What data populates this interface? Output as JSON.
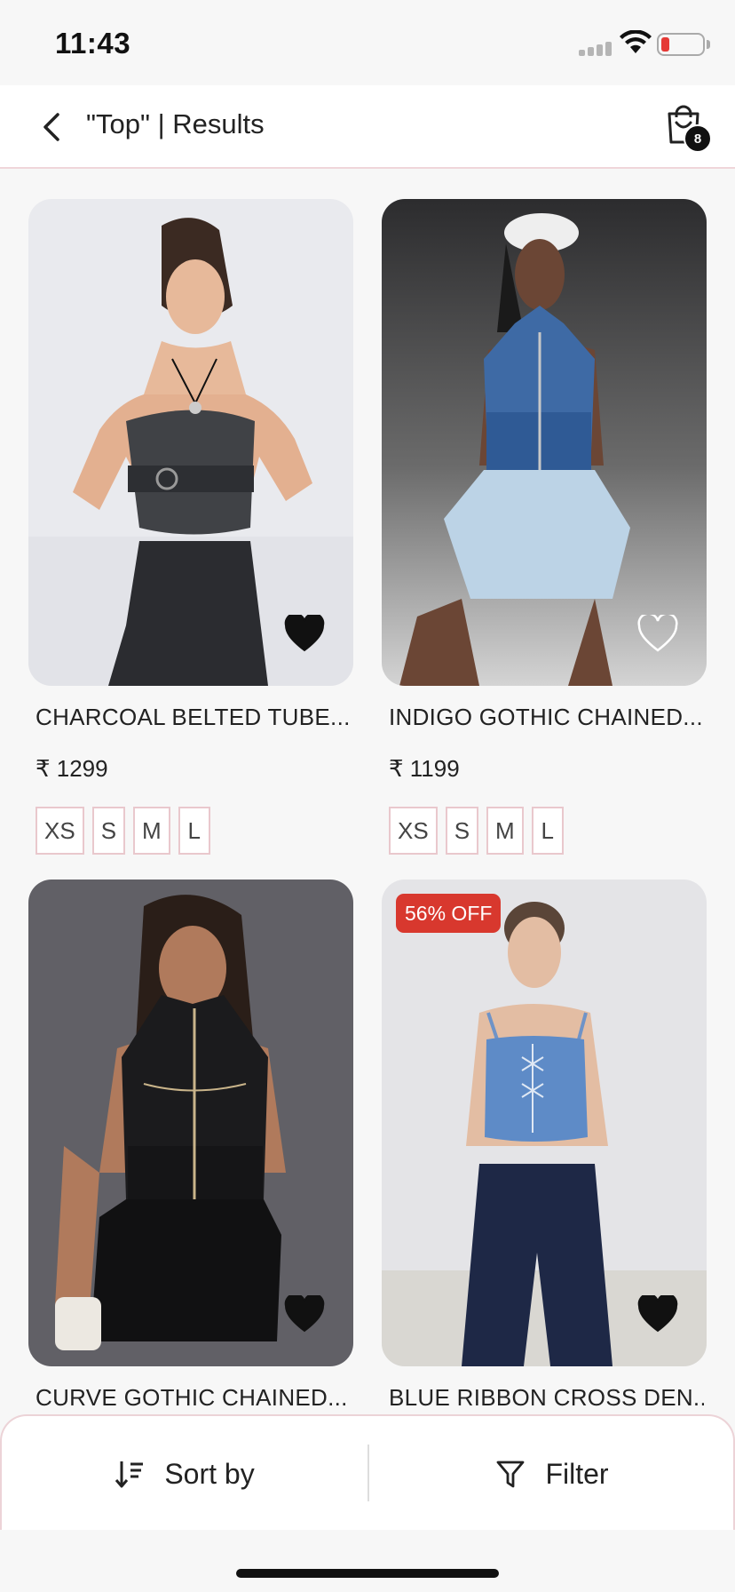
{
  "status_bar": {
    "time": "11:43"
  },
  "header": {
    "title": "\"Top\" | Results",
    "cart_count": "8"
  },
  "products": [
    {
      "name": "CHARCOAL BELTED TUBE...",
      "price": "₹ 1299",
      "sizes": [
        "XS",
        "S",
        "M",
        "L"
      ],
      "favorited": true,
      "discount": ""
    },
    {
      "name": "INDIGO GOTHIC CHAINED...",
      "price": "₹ 1199",
      "sizes": [
        "XS",
        "S",
        "M",
        "L"
      ],
      "favorited": false,
      "discount": ""
    },
    {
      "name": "CURVE GOTHIC CHAINED...",
      "favorited": true,
      "discount": ""
    },
    {
      "name": "BLUE RIBBON CROSS DEN...",
      "favorited": true,
      "discount": "56% OFF"
    }
  ],
  "bottom_bar": {
    "sort_label": "Sort by",
    "filter_label": "Filter"
  },
  "colors": {
    "accent_border": "#e9c8cd",
    "discount_bg": "#d8382e",
    "battery_low": "#e53935"
  },
  "icons": [
    "back-icon",
    "shopping-bag-icon",
    "heart-icon",
    "sort-icon",
    "filter-icon"
  ]
}
